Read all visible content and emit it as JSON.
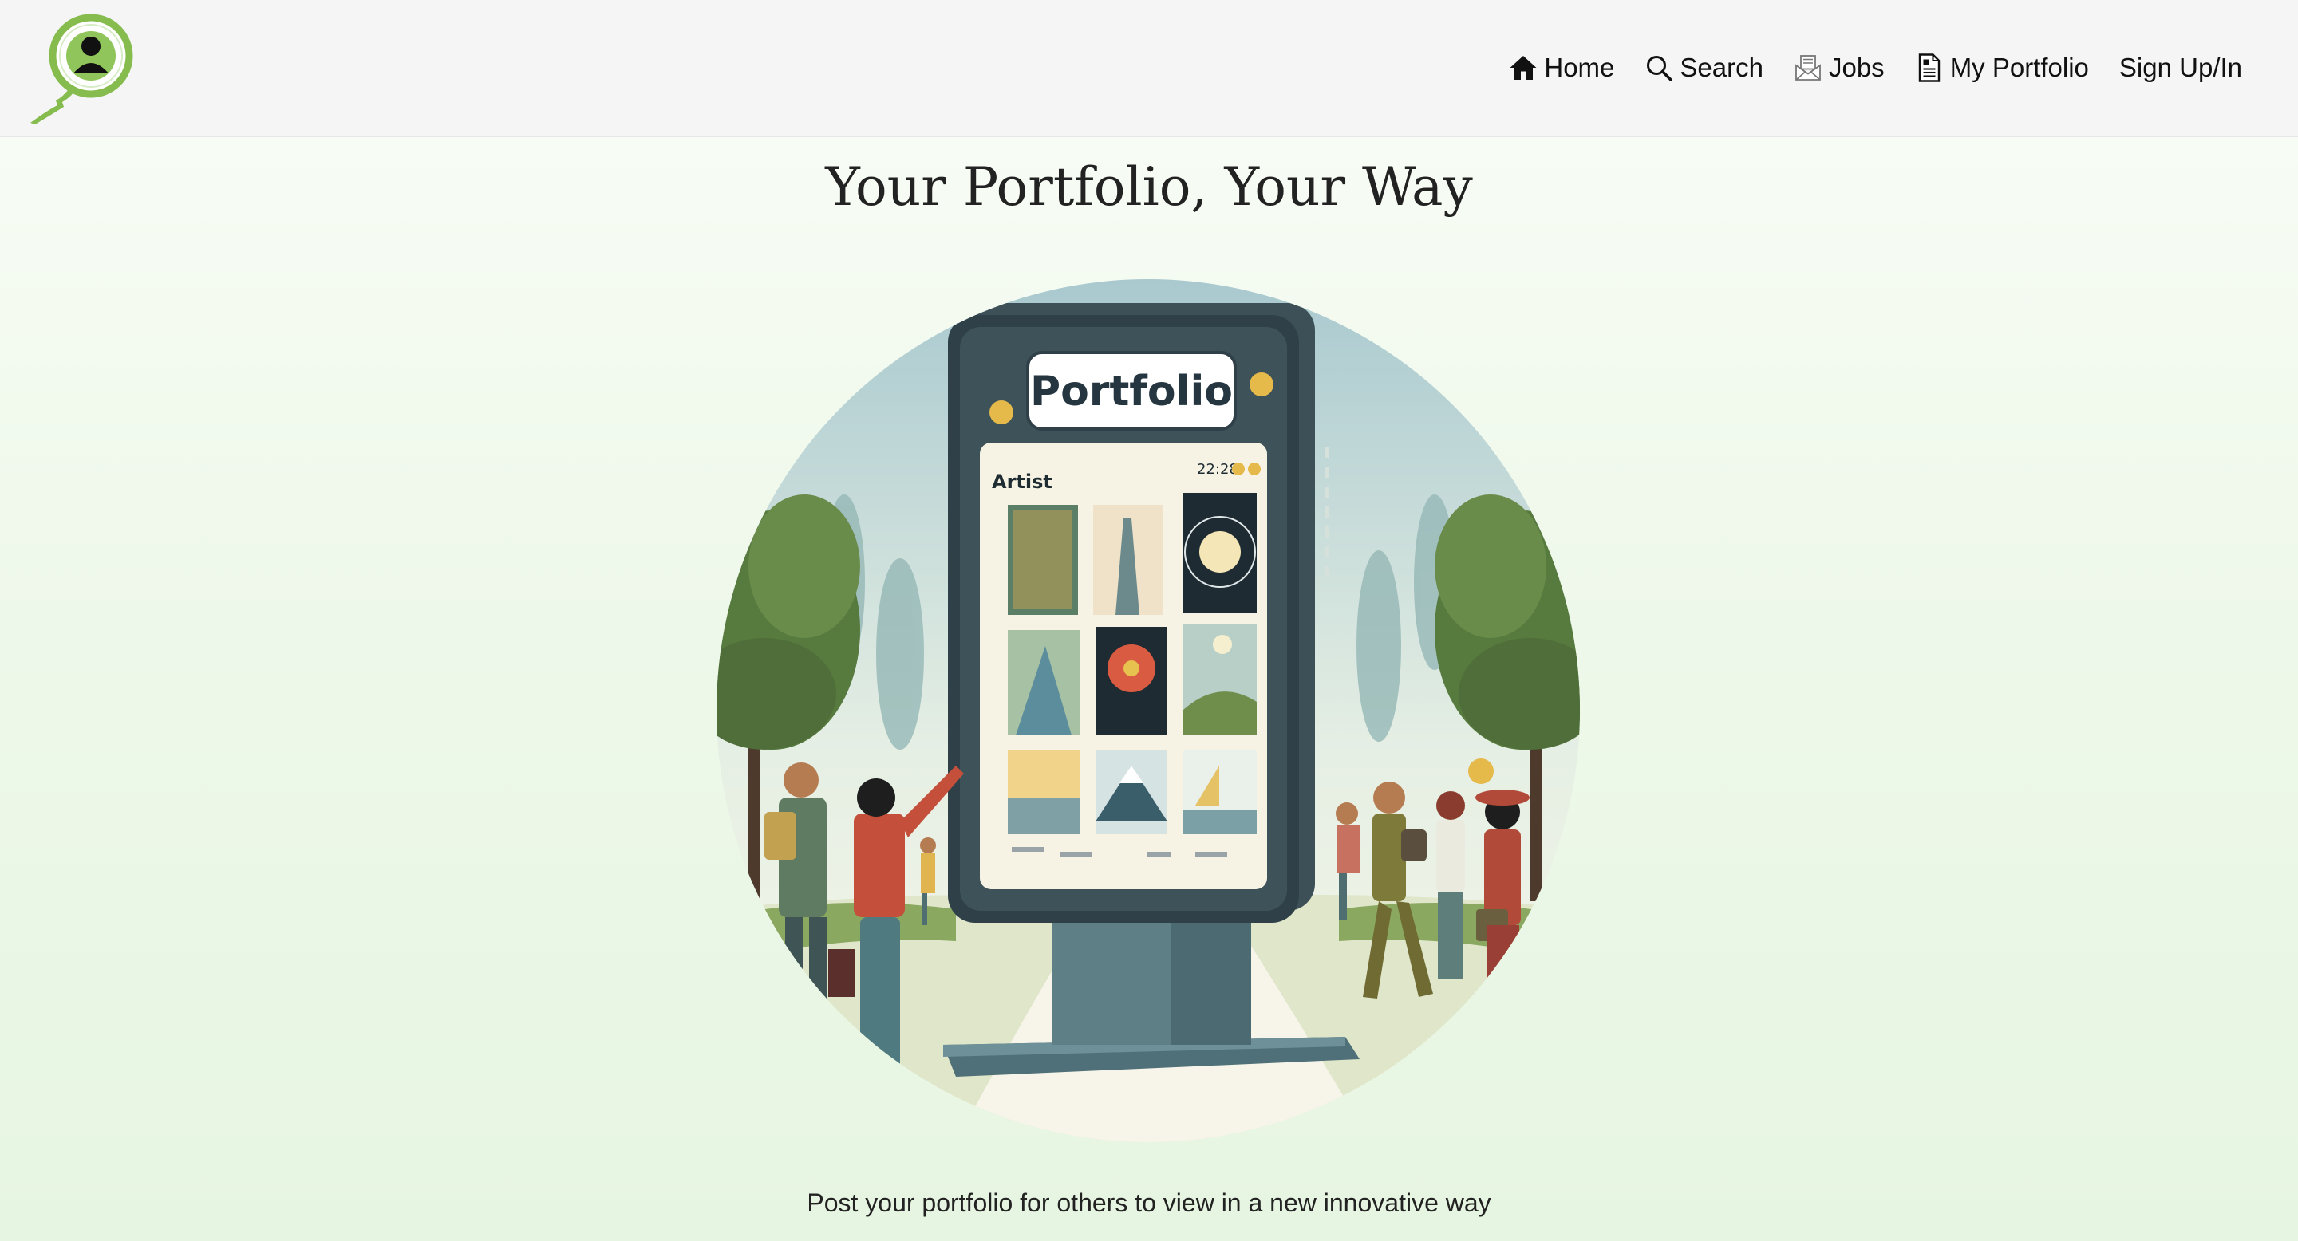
{
  "nav": {
    "home": "Home",
    "search": "Search",
    "jobs": "Jobs",
    "portfolio": "My Portfolio",
    "signin": "Sign Up/In"
  },
  "hero": {
    "title": "Your Portfolio, Your Way",
    "subtitle": "Post your portfolio for others to view in a new innovative way"
  },
  "illustration": {
    "sign_text": "Portfolio",
    "card_label": "Artist",
    "card_time": "22:28"
  },
  "colors": {
    "accent_green": "#7fb646",
    "kiosk_dark": "#2f4049",
    "kiosk_body": "#5e7f86"
  },
  "icons": [
    "logo-icon",
    "home-icon",
    "search-icon",
    "jobs-icon",
    "portfolio-icon"
  ]
}
